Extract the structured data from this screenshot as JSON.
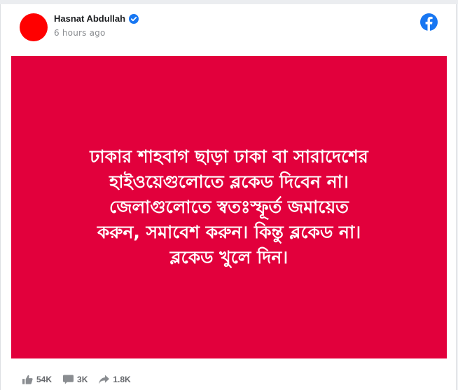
{
  "post": {
    "author": "Hasnat Abdullah",
    "timestamp": "6 hours ago",
    "verified_icon": "verified-badge-icon",
    "platform_icon": "facebook-logo-icon",
    "avatar_color": "#ff0000",
    "image_background": "#e2003c",
    "image_text": "ঢাকার শাহবাগ ছাড়া ঢাকা বা সারাদেশের\nহাইওয়েগুলোতে ব্লকেড দিবেন না।\nজেলাগুলোতে স্বতঃস্ফূর্ত জমায়েত\nকরুন, সমাবেশ করুন। কিন্তু ব্লকেড না।\nব্লকেড খুলে দিন।"
  },
  "stats": {
    "likes": "54K",
    "comments": "3K",
    "shares": "1.8K"
  }
}
